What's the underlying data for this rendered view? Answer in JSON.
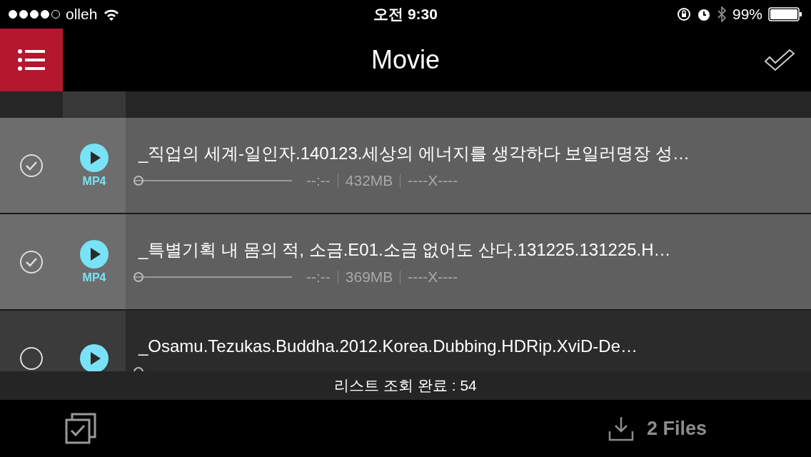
{
  "status_bar": {
    "carrier": "olleh",
    "time": "오전 9:30",
    "battery": "99%"
  },
  "header": {
    "title": "Movie"
  },
  "files": [
    {
      "title": "_직업의 세계-일인자.140123.세상의 에너지를 생각하다 보일러명장 성…",
      "format": "MP4",
      "checked": true,
      "level": 0,
      "duration": "--:--",
      "size": "432MB",
      "resolution": "----X----"
    },
    {
      "title": "_특별기획 내 몸의 적, 소금.E01.소금 없어도 산다.131225.131225.H…",
      "format": "MP4",
      "checked": true,
      "level": 0,
      "duration": "--:--",
      "size": "369MB",
      "resolution": "----X----"
    },
    {
      "title": "_Osamu.Tezukas.Buddha.2012.Korea.Dubbing.HDRip.XviD-De…",
      "checked": false,
      "level": 0
    }
  ],
  "toast": "리스트 조회 완료 : 54",
  "bottom_bar": {
    "download_label": "2 Files"
  }
}
